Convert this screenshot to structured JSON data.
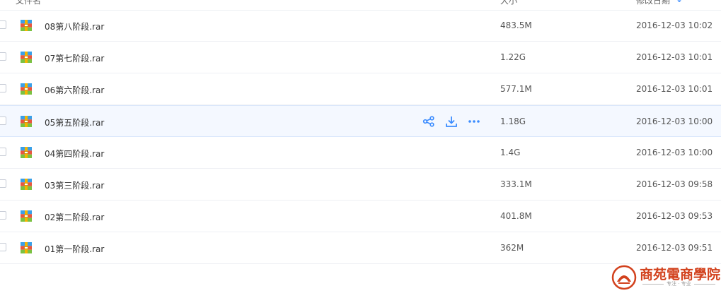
{
  "header": {
    "name_col": "文件名",
    "size_col": "大小",
    "date_col": "修改日期",
    "sort_indicator": "↓"
  },
  "files": [
    {
      "name": "08第八阶段.rar",
      "size": "483.5M",
      "date": "2016-12-03 10:02"
    },
    {
      "name": "07第七阶段.rar",
      "size": "1.22G",
      "date": "2016-12-03 10:01"
    },
    {
      "name": "06第六阶段.rar",
      "size": "577.1M",
      "date": "2016-12-03 10:01"
    },
    {
      "name": "05第五阶段.rar",
      "size": "1.18G",
      "date": "2016-12-03 10:00"
    },
    {
      "name": "04第四阶段.rar",
      "size": "1.4G",
      "date": "2016-12-03 10:00"
    },
    {
      "name": "03第三阶段.rar",
      "size": "333.1M",
      "date": "2016-12-03 09:58"
    },
    {
      "name": "02第二阶段.rar",
      "size": "401.8M",
      "date": "2016-12-03 09:53"
    },
    {
      "name": "01第一阶段.rar",
      "size": "362M",
      "date": "2016-12-03 09:51"
    }
  ],
  "hovered_row_index": 3,
  "row_actions": [
    {
      "icon": "share-icon"
    },
    {
      "icon": "download-icon"
    },
    {
      "icon": "more-icon"
    }
  ],
  "colors": {
    "accent": "#3b8cff",
    "hover_bg": "#f4f8ff",
    "logo_red": "#d2411d"
  },
  "watermark": {
    "title": "商苑電商學院",
    "subtitle": "专注 · 专业"
  }
}
